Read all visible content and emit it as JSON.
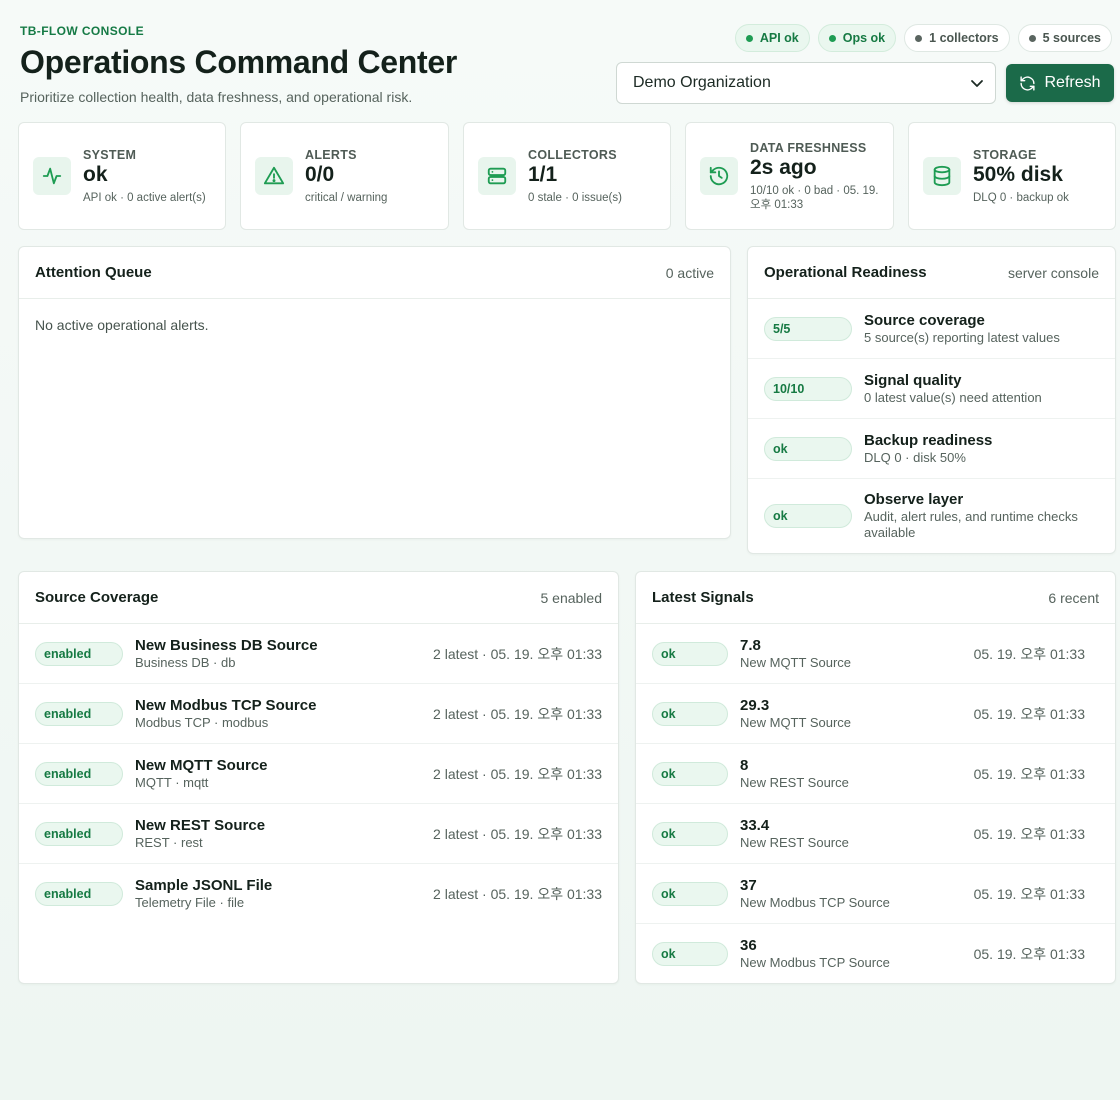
{
  "header": {
    "eyebrow": "TB-FLOW CONSOLE",
    "title": "Operations Command Center",
    "subtitle": "Prioritize collection health, data freshness, and operational risk."
  },
  "chips": [
    {
      "label": "API ok",
      "status": "ok"
    },
    {
      "label": "Ops ok",
      "status": "ok"
    },
    {
      "label": "1 collectors",
      "status": "neutral"
    },
    {
      "label": "5 sources",
      "status": "neutral"
    }
  ],
  "org_select": {
    "value": "Demo Organization"
  },
  "refresh": {
    "label": "Refresh"
  },
  "stats": [
    {
      "label": "SYSTEM",
      "value": "ok",
      "sub": "API ok · 0 active alert(s)",
      "icon": "activity-icon"
    },
    {
      "label": "ALERTS",
      "value": "0/0",
      "sub": "critical / warning",
      "icon": "warning-icon"
    },
    {
      "label": "COLLECTORS",
      "value": "1/1",
      "sub": "0 stale · 0 issue(s)",
      "icon": "server-icon"
    },
    {
      "label": "DATA FRESHNESS",
      "value": "2s ago",
      "sub": "10/10 ok · 0 bad · 05. 19. 오후 01:33",
      "icon": "history-icon"
    },
    {
      "label": "STORAGE",
      "value": "50% disk",
      "sub": "DLQ 0 · backup ok",
      "icon": "database-icon"
    }
  ],
  "attention": {
    "title": "Attention Queue",
    "meta": "0 active",
    "empty": "No active operational alerts."
  },
  "readiness": {
    "title": "Operational Readiness",
    "meta": "server console",
    "items": [
      {
        "badge": "5/5",
        "title": "Source coverage",
        "sub": "5 source(s) reporting latest values"
      },
      {
        "badge": "10/10",
        "title": "Signal quality",
        "sub": "0 latest value(s) need attention"
      },
      {
        "badge": "ok",
        "title": "Backup readiness",
        "sub": "DLQ 0 · disk 50%"
      },
      {
        "badge": "ok",
        "title": "Observe layer",
        "sub": "Audit, alert rules, and runtime checks available"
      }
    ]
  },
  "coverage": {
    "title": "Source Coverage",
    "meta": "5 enabled",
    "items": [
      {
        "badge": "enabled",
        "title": "New Business DB Source",
        "sub": "Business DB · db",
        "right": "2 latest · 05. 19. 오후 01:33"
      },
      {
        "badge": "enabled",
        "title": "New Modbus TCP Source",
        "sub": "Modbus TCP · modbus",
        "right": "2 latest · 05. 19. 오후 01:33"
      },
      {
        "badge": "enabled",
        "title": "New MQTT Source",
        "sub": "MQTT · mqtt",
        "right": "2 latest · 05. 19. 오후 01:33"
      },
      {
        "badge": "enabled",
        "title": "New REST Source",
        "sub": "REST · rest",
        "right": "2 latest · 05. 19. 오후 01:33"
      },
      {
        "badge": "enabled",
        "title": "Sample JSONL File",
        "sub": "Telemetry File · file",
        "right": "2 latest · 05. 19. 오후 01:33"
      }
    ]
  },
  "signals": {
    "title": "Latest Signals",
    "meta": "6 recent",
    "items": [
      {
        "badge": "ok",
        "title": "7.8",
        "sub": "New MQTT Source",
        "right": "05. 19. 오후 01:33"
      },
      {
        "badge": "ok",
        "title": "29.3",
        "sub": "New MQTT Source",
        "right": "05. 19. 오후 01:33"
      },
      {
        "badge": "ok",
        "title": "8",
        "sub": "New REST Source",
        "right": "05. 19. 오후 01:33"
      },
      {
        "badge": "ok",
        "title": "33.4",
        "sub": "New REST Source",
        "right": "05. 19. 오후 01:33"
      },
      {
        "badge": "ok",
        "title": "37",
        "sub": "New Modbus TCP Source",
        "right": "05. 19. 오후 01:33"
      },
      {
        "badge": "ok",
        "title": "36",
        "sub": "New Modbus TCP Source",
        "right": "05. 19. 오후 01:33"
      }
    ]
  },
  "colors": {
    "accent": "#1b6a49",
    "ok": "#167a43",
    "ok_bg": "#eaf7ef"
  }
}
